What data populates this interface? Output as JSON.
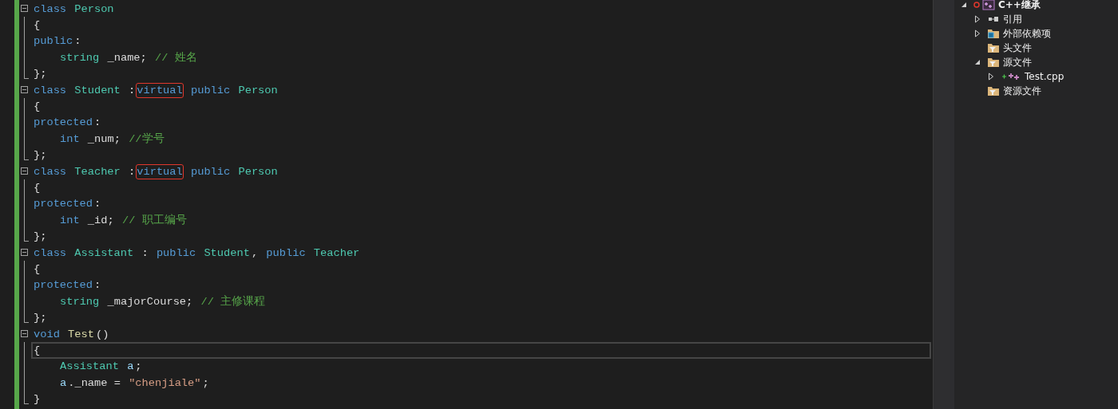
{
  "editor": {
    "lines": [
      {
        "kind": "start",
        "tokens": [
          {
            "kind": "keyword",
            "text": "class "
          },
          {
            "kind": "type",
            "text": "Person"
          }
        ]
      },
      {
        "kind": "body",
        "tokens": [
          {
            "kind": "plain",
            "text": "{"
          }
        ]
      },
      {
        "kind": "body",
        "tokens": [
          {
            "kind": "keyword",
            "text": "public"
          },
          {
            "kind": "plain",
            "text": ":"
          }
        ]
      },
      {
        "kind": "body",
        "indented": true,
        "tokens": [
          {
            "kind": "type",
            "text": "string "
          },
          {
            "kind": "plain",
            "text": "_name; "
          },
          {
            "kind": "comment",
            "text": "// 姓名"
          }
        ]
      },
      {
        "kind": "end",
        "tokens": [
          {
            "kind": "plain",
            "text": "};"
          }
        ]
      },
      {
        "kind": "start",
        "tokens": [
          {
            "kind": "keyword",
            "text": "class "
          },
          {
            "kind": "type",
            "text": "Student "
          },
          {
            "kind": "plain",
            "text": ":"
          },
          {
            "kind": "keyword",
            "text": "virtual",
            "outlined": true
          },
          {
            "kind": "keyword",
            "text": " public "
          },
          {
            "kind": "type",
            "text": "Person"
          }
        ]
      },
      {
        "kind": "body",
        "tokens": [
          {
            "kind": "plain",
            "text": "{"
          }
        ]
      },
      {
        "kind": "body",
        "tokens": [
          {
            "kind": "keyword",
            "text": "protected"
          },
          {
            "kind": "plain",
            "text": ":"
          }
        ]
      },
      {
        "kind": "body",
        "indented": true,
        "tokens": [
          {
            "kind": "keyword",
            "text": "int "
          },
          {
            "kind": "plain",
            "text": "_num; "
          },
          {
            "kind": "comment",
            "text": "//学号"
          }
        ]
      },
      {
        "kind": "end",
        "tokens": [
          {
            "kind": "plain",
            "text": "};"
          }
        ]
      },
      {
        "kind": "start",
        "tokens": [
          {
            "kind": "keyword",
            "text": "class "
          },
          {
            "kind": "type",
            "text": "Teacher "
          },
          {
            "kind": "plain",
            "text": ":"
          },
          {
            "kind": "keyword",
            "text": "virtual",
            "outlined": true
          },
          {
            "kind": "keyword",
            "text": " public "
          },
          {
            "kind": "type",
            "text": "Person"
          }
        ]
      },
      {
        "kind": "body",
        "tokens": [
          {
            "kind": "plain",
            "text": "{"
          }
        ]
      },
      {
        "kind": "body",
        "tokens": [
          {
            "kind": "keyword",
            "text": "protected"
          },
          {
            "kind": "plain",
            "text": ":"
          }
        ]
      },
      {
        "kind": "body",
        "indented": true,
        "tokens": [
          {
            "kind": "keyword",
            "text": "int "
          },
          {
            "kind": "plain",
            "text": "_id; "
          },
          {
            "kind": "comment",
            "text": "// 职工编号"
          }
        ]
      },
      {
        "kind": "end",
        "tokens": [
          {
            "kind": "plain",
            "text": "};"
          }
        ]
      },
      {
        "kind": "start",
        "tokens": [
          {
            "kind": "keyword",
            "text": "class "
          },
          {
            "kind": "type",
            "text": "Assistant "
          },
          {
            "kind": "plain",
            "text": ": "
          },
          {
            "kind": "keyword",
            "text": "public "
          },
          {
            "kind": "type",
            "text": "Student"
          },
          {
            "kind": "plain",
            "text": ", "
          },
          {
            "kind": "keyword",
            "text": "public "
          },
          {
            "kind": "type",
            "text": "Teacher"
          }
        ]
      },
      {
        "kind": "body",
        "tokens": [
          {
            "kind": "plain",
            "text": "{"
          }
        ]
      },
      {
        "kind": "body",
        "tokens": [
          {
            "kind": "keyword",
            "text": "protected"
          },
          {
            "kind": "plain",
            "text": ":"
          }
        ]
      },
      {
        "kind": "body",
        "indented": true,
        "tokens": [
          {
            "kind": "type",
            "text": "string "
          },
          {
            "kind": "plain",
            "text": "_majorCourse; "
          },
          {
            "kind": "comment",
            "text": "// 主修课程"
          }
        ]
      },
      {
        "kind": "end",
        "tokens": [
          {
            "kind": "plain",
            "text": "};"
          }
        ]
      },
      {
        "kind": "start",
        "tokens": [
          {
            "kind": "keyword",
            "text": "void "
          },
          {
            "kind": "function",
            "text": "Test"
          },
          {
            "kind": "plain",
            "text": "()"
          }
        ]
      },
      {
        "kind": "body",
        "current": true,
        "tokens": [
          {
            "kind": "plain",
            "text": "{"
          }
        ]
      },
      {
        "kind": "body",
        "indented": true,
        "tokens": [
          {
            "kind": "type",
            "text": "Assistant "
          },
          {
            "kind": "variable",
            "text": "a"
          },
          {
            "kind": "plain",
            "text": ";"
          }
        ]
      },
      {
        "kind": "body",
        "indented": true,
        "tokens": [
          {
            "kind": "variable",
            "text": "a"
          },
          {
            "kind": "plain",
            "text": "._name = "
          },
          {
            "kind": "string",
            "text": "\"chenjiale\""
          },
          {
            "kind": "plain",
            "text": ";"
          }
        ]
      },
      {
        "kind": "end",
        "tokens": [
          {
            "kind": "plain",
            "text": "}"
          }
        ]
      }
    ]
  },
  "solution_explorer": {
    "items": [
      {
        "label": "C++继承",
        "kind": "project",
        "expanded": true,
        "children": [
          {
            "label": "引用",
            "kind": "references",
            "expanded": false
          },
          {
            "label": "外部依赖项",
            "kind": "external",
            "expanded": false
          },
          {
            "label": "头文件",
            "kind": "filter"
          },
          {
            "label": "源文件",
            "kind": "filter",
            "expanded": true,
            "children": [
              {
                "label": "Test.cpp",
                "kind": "cpp",
                "expanded": false
              }
            ]
          },
          {
            "label": "资源文件",
            "kind": "filter"
          }
        ]
      }
    ]
  }
}
